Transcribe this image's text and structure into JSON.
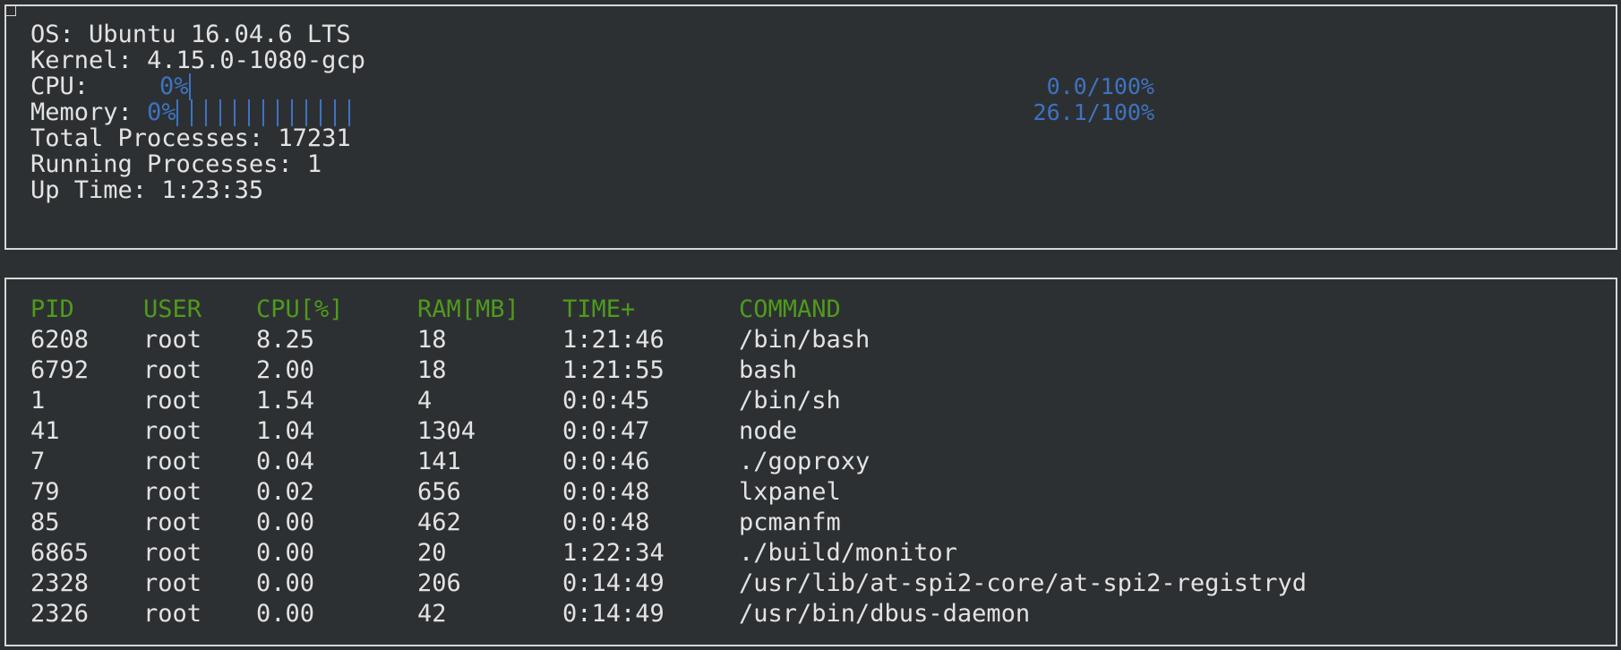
{
  "system": {
    "os_label": "OS:",
    "os_value": "Ubuntu 16.04.6 LTS",
    "kernel_label": "Kernel:",
    "kernel_value": "4.15.0-1080-gcp",
    "cpu": {
      "label": "CPU:",
      "percent_label": "0%",
      "bar_ticks": 1,
      "value_text": "0.0/100%"
    },
    "memory": {
      "label": "Memory:",
      "percent_label": "0%",
      "bar_ticks": 13,
      "value_text": "26.1/100%"
    },
    "total_processes_label": "Total Processes:",
    "total_processes_value": "17231",
    "running_processes_label": "Running Processes:",
    "running_processes_value": "1",
    "uptime_label": "Up Time:",
    "uptime_value": "1:23:35"
  },
  "process_table": {
    "headers": [
      "PID",
      "USER",
      "CPU[%]",
      "RAM[MB]",
      "TIME+",
      "COMMAND"
    ],
    "rows": [
      [
        "6208",
        "root",
        "8.25",
        "18",
        "1:21:46",
        "/bin/bash"
      ],
      [
        "6792",
        "root",
        "2.00",
        "18",
        "1:21:55",
        "bash"
      ],
      [
        "1",
        "root",
        "1.54",
        "4",
        "0:0:45",
        "/bin/sh"
      ],
      [
        "41",
        "root",
        "1.04",
        "1304",
        "0:0:47",
        "node"
      ],
      [
        "7",
        "root",
        "0.04",
        "141",
        "0:0:46",
        "./goproxy"
      ],
      [
        "79",
        "root",
        "0.02",
        "656",
        "0:0:48",
        "lxpanel"
      ],
      [
        "85",
        "root",
        "0.00",
        "462",
        "0:0:48",
        "pcmanfm"
      ],
      [
        "6865",
        "root",
        "0.00",
        "20",
        "1:22:34",
        "./build/monitor"
      ],
      [
        "2328",
        "root",
        "0.00",
        "206",
        "0:14:49",
        "/usr/lib/at-spi2-core/at-spi2-registryd"
      ],
      [
        "2326",
        "root",
        "0.00",
        "42",
        "0:14:49",
        "/usr/bin/dbus-daemon"
      ]
    ]
  },
  "colors": {
    "background": "#2d3033",
    "text": "#e3e3e3",
    "bar_blue": "#3e73c1",
    "header_green": "#4f9a1c",
    "border": "#d7d7d7"
  }
}
